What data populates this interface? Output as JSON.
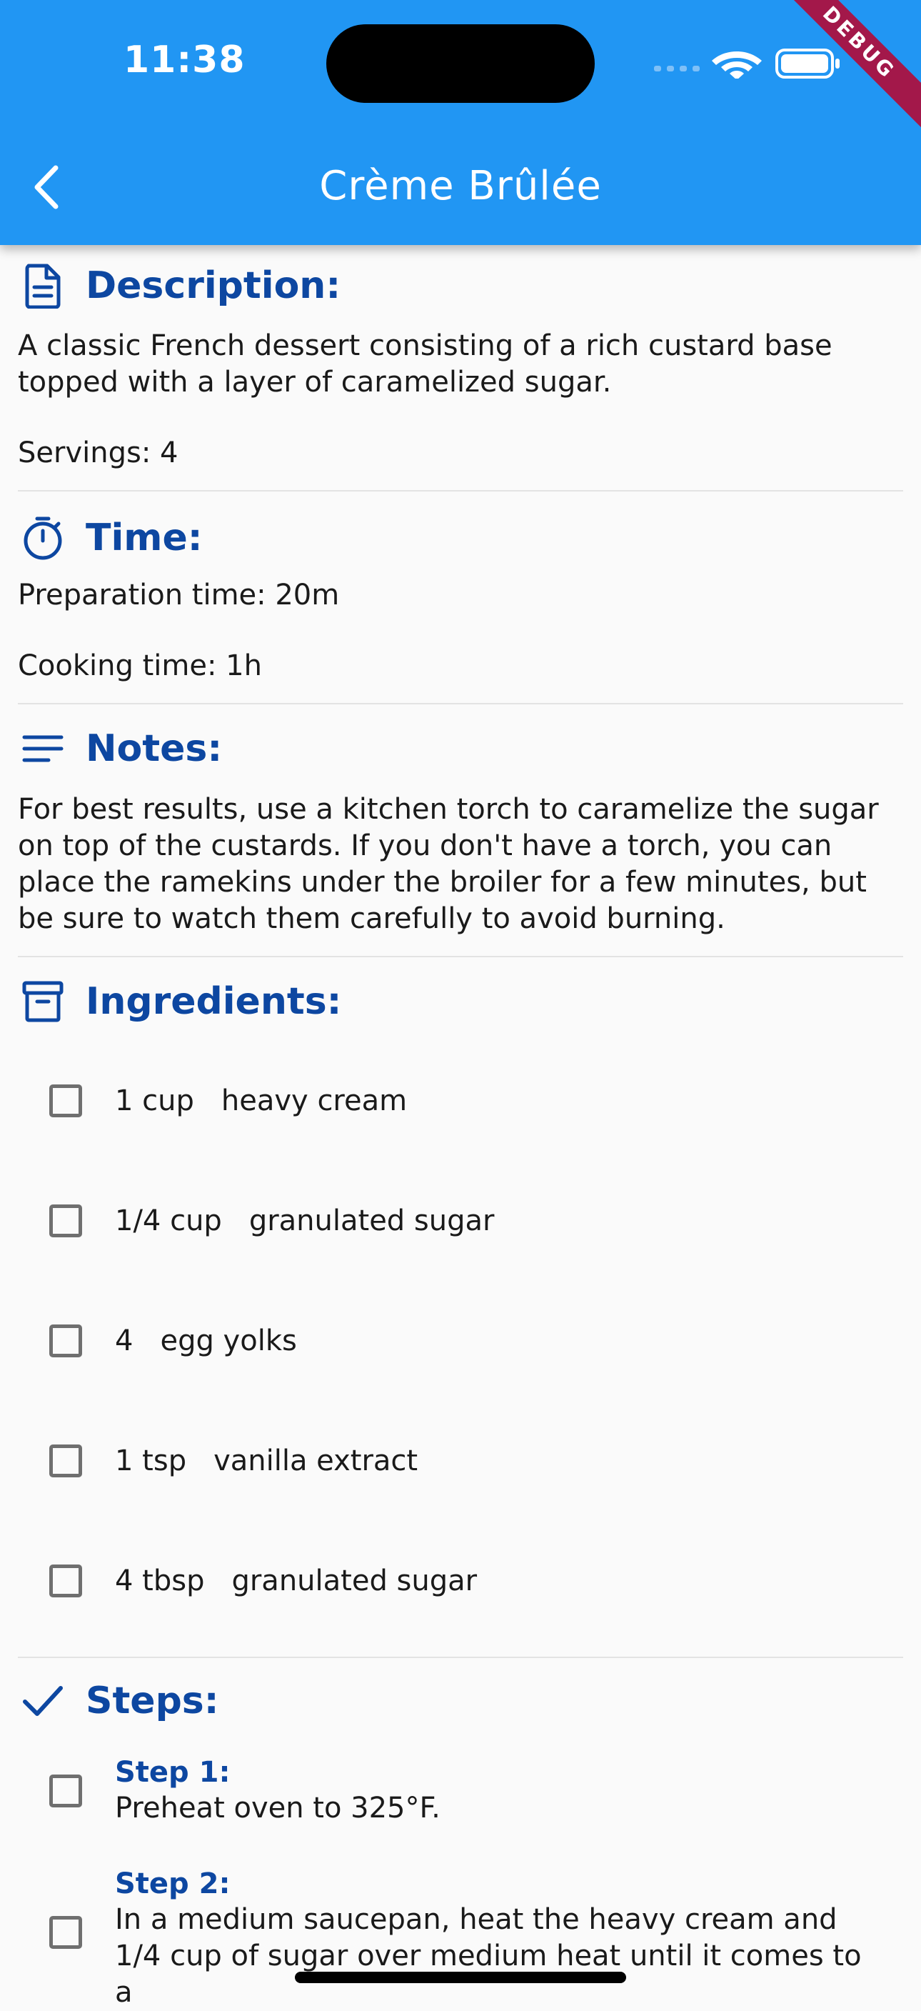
{
  "status_bar": {
    "time": "11:38",
    "debug_label": "DEBUG"
  },
  "app_bar": {
    "title": "Crème Brûlée",
    "back_icon": "chevron-left-icon"
  },
  "description": {
    "heading": "Description:",
    "icon": "document-icon",
    "text": "A classic French dessert consisting of a rich custard base topped with a layer of caramelized sugar.",
    "servings": "Servings: 4"
  },
  "time_section": {
    "heading": "Time:",
    "icon": "timer-icon",
    "prep": "Preparation time: 20m",
    "cook": "Cooking time: 1h"
  },
  "notes": {
    "heading": "Notes:",
    "icon": "notes-icon",
    "text": "For best results, use a kitchen torch to caramelize the sugar on top of the custards. If you don't have a torch, you can place the ramekins under the broiler for a few minutes, but be sure to watch them carefully to avoid burning."
  },
  "ingredients": {
    "heading": "Ingredients:",
    "icon": "archive-box-icon",
    "items": [
      {
        "qty": "1 cup",
        "name": "heavy cream"
      },
      {
        "qty": "1/4 cup",
        "name": "granulated sugar"
      },
      {
        "qty": "4",
        "name": "egg yolks"
      },
      {
        "qty": "1 tsp",
        "name": "vanilla extract"
      },
      {
        "qty": "4 tbsp",
        "name": "granulated sugar"
      }
    ]
  },
  "steps": {
    "heading": "Steps:",
    "icon": "checkmark-icon",
    "items": [
      {
        "label": "Step 1:",
        "text": "Preheat oven to 325°F."
      },
      {
        "label": "Step 2:",
        "text": "In a medium saucepan, heat the heavy cream and 1/4 cup of sugar over medium heat until it comes to a"
      }
    ]
  },
  "colors": {
    "app_bar": "#2196f3",
    "heading": "#0d47a1",
    "background": "#fafafa",
    "debug_ribbon": "#a3184a"
  }
}
